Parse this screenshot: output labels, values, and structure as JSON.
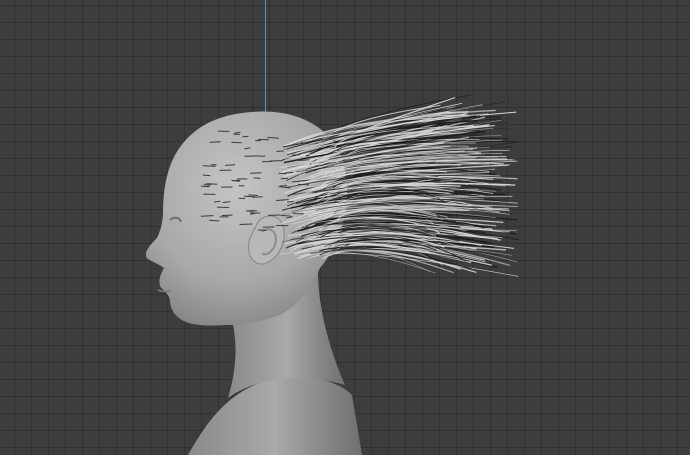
{
  "viewport": {
    "background_color": "#3d3d3d",
    "grid_color": "#353535",
    "z_axis_color": "#5c93c9"
  },
  "model": {
    "mesh_color": "#a9a9a9",
    "hair_strand_color": "#d9d9d9",
    "hair_shadow_color": "#1a1a1a"
  }
}
